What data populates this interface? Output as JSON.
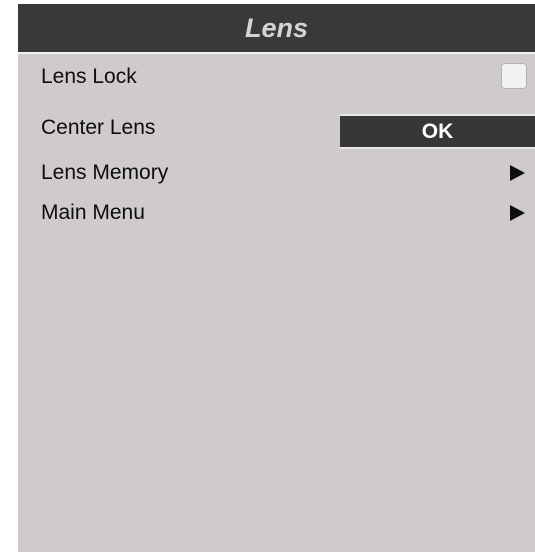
{
  "menu": {
    "title": "Lens",
    "items": [
      {
        "label": "Lens Lock",
        "control": "checkbox",
        "checked": false
      },
      {
        "label": "Center Lens",
        "control": "button",
        "button_label": "OK"
      },
      {
        "label": "Lens Memory",
        "control": "submenu-arrow"
      },
      {
        "label": "Main Menu",
        "control": "submenu-arrow"
      }
    ]
  },
  "colors": {
    "title_bar": "#3a3838",
    "title_text": "#d6d3d3",
    "panel": "#cfcbca",
    "button": "#383636"
  },
  "icons": {
    "submenu": "triangle-right-icon"
  }
}
